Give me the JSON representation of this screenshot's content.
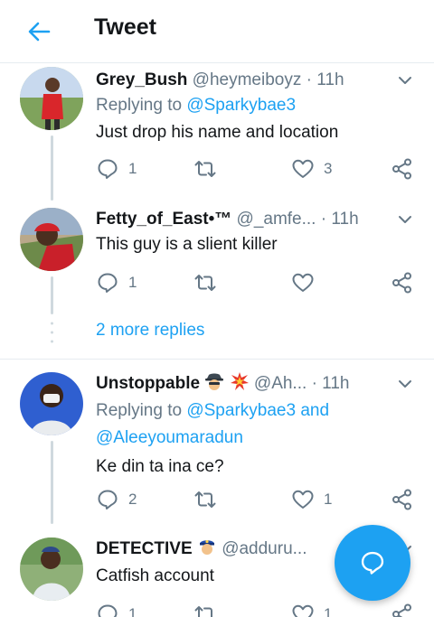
{
  "header": {
    "title": "Tweet",
    "back_icon": "arrow-left-icon",
    "accent": "#1da1f2"
  },
  "tweets": [
    {
      "name": "Grey_Bush",
      "handle": "@heymeiboyz",
      "dot": "·",
      "time": "11h",
      "replying_prefix": "Replying to ",
      "mentions": [
        "@Sparkybae3"
      ],
      "text": "Just drop his name and location",
      "reply_count": "1",
      "retweet_count": "",
      "like_count": "3"
    },
    {
      "name": "Fetty_of_East•™",
      "handle": "@_amfe...",
      "dot": "·",
      "time": "11h",
      "text": "This guy is a slient killer",
      "reply_count": "1",
      "retweet_count": "",
      "like_count": ""
    },
    {
      "name": "Unstoppable",
      "emoji": [
        "spy-emoji-icon",
        "collision-emoji-icon"
      ],
      "handle": "@Ah...",
      "dot": "·",
      "time": "11h",
      "replying_prefix": "Replying to ",
      "mentions": [
        "@Sparkybae3",
        "@Aleeyoumaradun"
      ],
      "and": " and",
      "text": "Ke din ta ina ce?",
      "reply_count": "2",
      "retweet_count": "",
      "like_count": "1"
    },
    {
      "name": "DETECTIVE",
      "emoji": [
        "police-officer-emoji-icon"
      ],
      "handle": "@adduru...",
      "dot": "·",
      "time": "",
      "text": "Catfish account",
      "reply_count": "1",
      "retweet_count": "",
      "like_count": "1"
    }
  ],
  "more_replies": "2 more replies",
  "fab": {
    "icon": "reply-bubble-icon"
  }
}
